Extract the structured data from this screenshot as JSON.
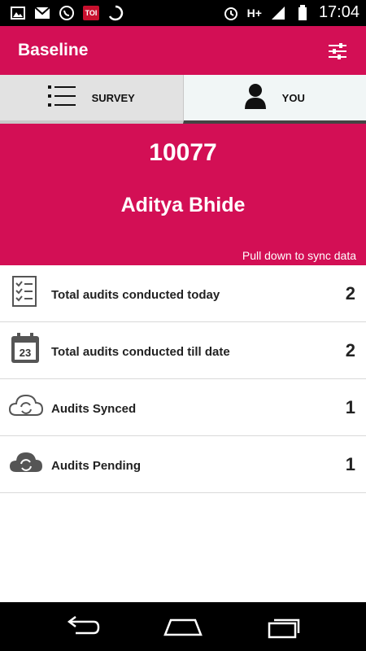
{
  "status_bar": {
    "left_icons": [
      "image-icon",
      "gmail-icon",
      "whatsapp-icon",
      "toi-icon",
      "sync-circle-icon"
    ],
    "toi_label": "TOI",
    "network": "H+",
    "time": "17:04"
  },
  "app_bar": {
    "title": "Baseline",
    "action_icon": "settings-sliders-icon"
  },
  "tabs": [
    {
      "label": "SURVEY",
      "icon": "list-icon",
      "selected": false
    },
    {
      "label": "YOU",
      "icon": "person-icon",
      "selected": true
    }
  ],
  "profile": {
    "id": "10077",
    "name": "Aditya Bhide",
    "sync_hint": "Pull down to sync data"
  },
  "stats": [
    {
      "label": "Total audits conducted today",
      "count": "2",
      "icon": "checklist-icon"
    },
    {
      "label": "Total audits conducted till date",
      "count": "2",
      "icon": "calendar-icon",
      "icon_text": "23"
    },
    {
      "label": "Audits Synced",
      "count": "1",
      "icon": "cloud-synced-icon"
    },
    {
      "label": "Audits Pending",
      "count": "1",
      "icon": "cloud-pending-icon"
    }
  ],
  "colors": {
    "primary": "#d30f55",
    "status_bar": "#000000",
    "nav_bar": "#000000"
  },
  "nav_bar": [
    "back-icon",
    "home-icon",
    "recents-icon"
  ]
}
